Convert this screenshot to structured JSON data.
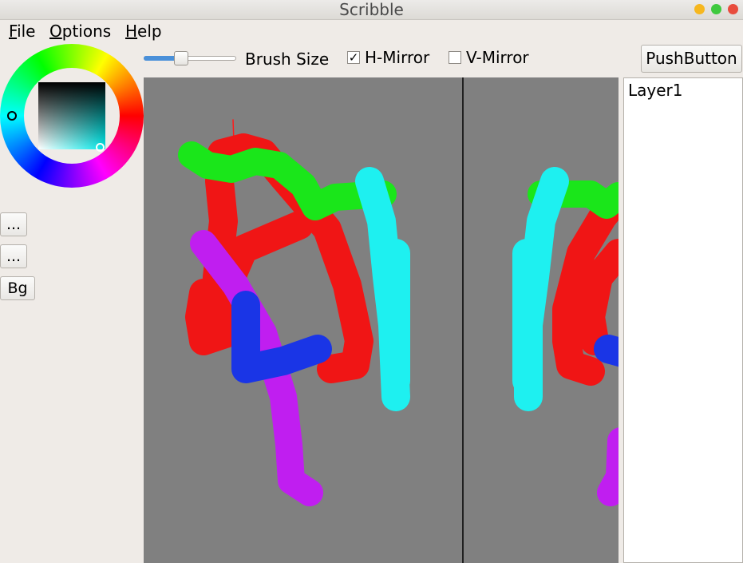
{
  "window": {
    "title": "Scribble",
    "controls": {
      "minimize_color": "#f6b71e",
      "maximize_color": "#3ec93e",
      "close_color": "#e84c3d"
    }
  },
  "menu": {
    "file": {
      "underline": "F",
      "rest": "ile"
    },
    "options": {
      "underline": "O",
      "rest": "ptions"
    },
    "help": {
      "underline": "H",
      "rest": "elp"
    }
  },
  "color_picker": {
    "hue_color": "#00e5e5"
  },
  "side_buttons": {
    "btn1": "...",
    "btn2": "...",
    "bg": "Bg"
  },
  "toolbar": {
    "brush_size_label": "Brush Size",
    "brush_size_level": 0.4,
    "h_mirror_label": "H-Mirror",
    "h_mirror_checked": "✓",
    "v_mirror_label": "V-Mirror",
    "push_button": "PushButton"
  },
  "canvas": {
    "background": "#808080"
  },
  "layers": {
    "items": [
      "Layer1"
    ]
  }
}
